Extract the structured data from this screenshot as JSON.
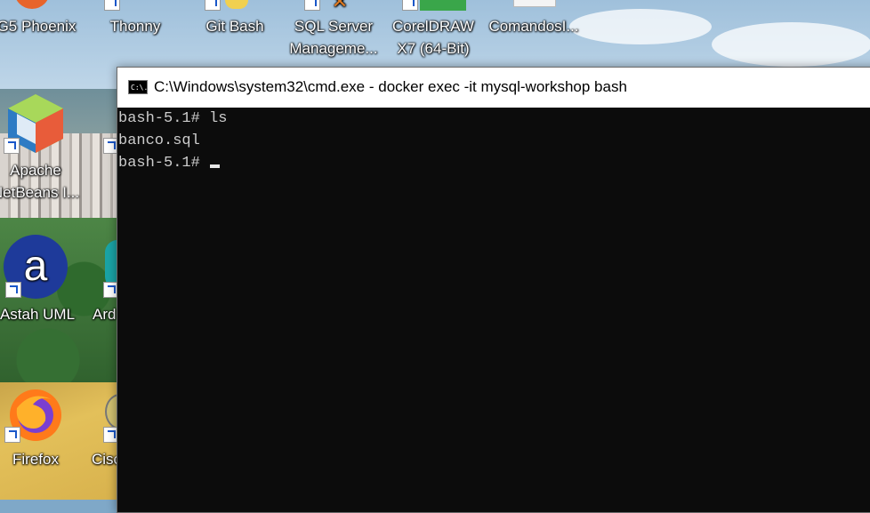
{
  "desktop": {
    "icons": [
      {
        "label": "G5 Phoenix",
        "icon": "phoenix-app-icon"
      },
      {
        "label": "Thonny",
        "icon": "thonny-app-icon"
      },
      {
        "label": "Git Bash",
        "icon": "git-bash-icon"
      },
      {
        "label_line1": "SQL Server",
        "label_line2": "Manageme...",
        "icon": "sql-server-management-icon"
      },
      {
        "label_line1": "CorelDRAW",
        "label_line2": "X7 (64-Bit)",
        "icon": "coreldraw-icon"
      },
      {
        "label": "ComandosI...",
        "icon": "document-file-icon"
      },
      {
        "label_line1": "Apache",
        "label_line2": "NetBeans I...",
        "icon": "netbeans-icon"
      },
      {
        "label": "Astah UML",
        "icon": "astah-uml-icon"
      },
      {
        "label": "Ard",
        "icon": "arduino-icon"
      },
      {
        "label": "Firefox",
        "icon": "firefox-icon"
      },
      {
        "label": "Cisc",
        "icon": "cisco-icon"
      }
    ]
  },
  "window": {
    "title": "C:\\Windows\\system32\\cmd.exe - docker  exec -it mysql-workshop bash",
    "icon_text": "C:\\.",
    "console_lines": [
      "bash-5.1# ls",
      "banco.sql",
      "bash-5.1# "
    ]
  },
  "colors": {
    "console_bg": "#0c0c0c",
    "console_text": "#cccccc",
    "titlebar_bg": "#ffffff"
  }
}
